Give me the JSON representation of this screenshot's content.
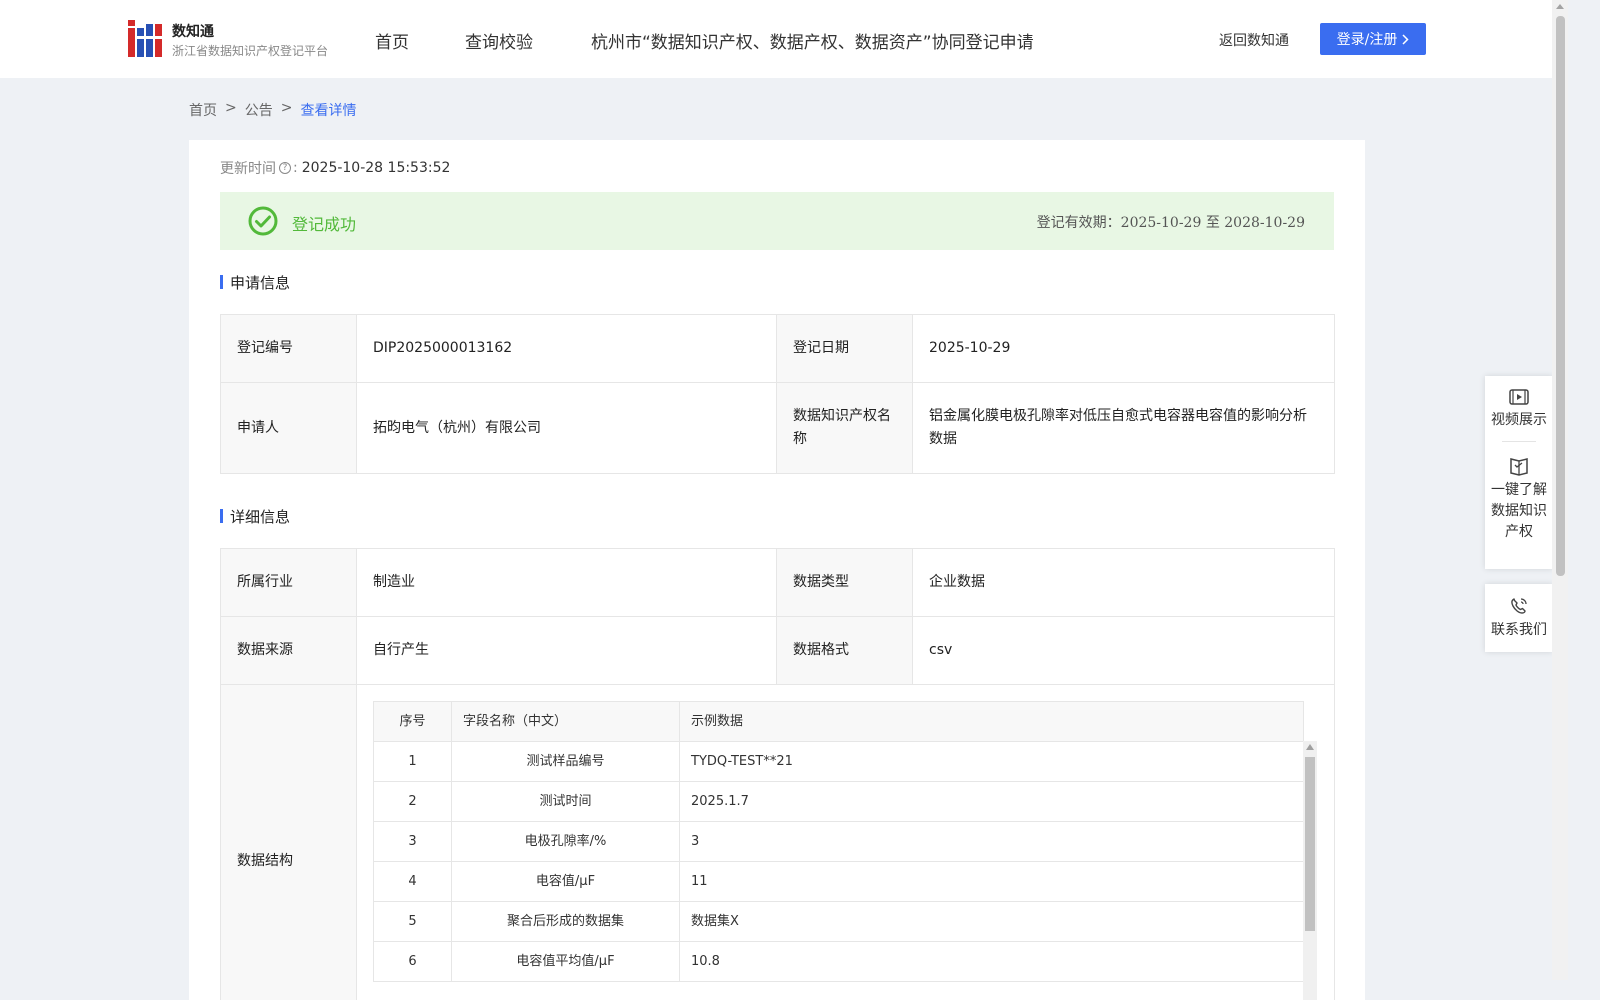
{
  "header": {
    "logo_title": "数知通",
    "logo_subtitle": "浙江省数据知识产权登记平台",
    "nav": [
      "首页",
      "查询校验",
      "杭州市“数据知识产权、数据产权、数据资产”协同登记申请"
    ],
    "back_link": "返回数知通",
    "login_label": "登录/注册"
  },
  "breadcrumb": [
    "首页",
    "公告",
    "查看详情"
  ],
  "update": {
    "label": "更新时间",
    "value": "2025-10-28 15:53:52"
  },
  "status": {
    "text": "登记成功",
    "validity_label": "登记有效期：",
    "validity_dates": "2025-10-29 至 2028-10-29",
    "color": "#52b93a"
  },
  "application_section": {
    "title": "申请信息",
    "rows": [
      [
        {
          "label": "登记编号",
          "value": "DIP2025000013162"
        },
        {
          "label": "登记日期",
          "value": "2025-10-29"
        }
      ],
      [
        {
          "label": "申请人",
          "value": "拓昀电气（杭州）有限公司"
        },
        {
          "label": "数据知识产权名称",
          "value": "铝金属化膜电极孔隙率对低压自愈式电容器电容值的影响分析数据"
        }
      ]
    ]
  },
  "detail_section": {
    "title": "详细信息",
    "rows": [
      [
        {
          "label": "所属行业",
          "value": "制造业"
        },
        {
          "label": "数据类型",
          "value": "企业数据"
        }
      ],
      [
        {
          "label": "数据来源",
          "value": "自行产生"
        },
        {
          "label": "数据格式",
          "value": "csv"
        }
      ]
    ],
    "structure_label": "数据结构",
    "structure_headers": [
      "序号",
      "字段名称（中文）",
      "示例数据"
    ],
    "structure_rows": [
      [
        "1",
        "测试样品编号",
        "TYDQ-TEST**21"
      ],
      [
        "2",
        "测试时间",
        "2025.1.7"
      ],
      [
        "3",
        "电极孔隙率/%",
        "3"
      ],
      [
        "4",
        "电容值/μF",
        "11"
      ],
      [
        "5",
        "聚合后形成的数据集",
        "数据集X"
      ],
      [
        "6",
        "电容值平均值/μF",
        "10.8"
      ]
    ]
  },
  "float_panel": {
    "video": "视频展示",
    "learn": "一键了解数据知识产权",
    "contact": "联系我们"
  },
  "colors": {
    "accent": "#3a6df0",
    "success": "#52b93a",
    "success_bg": "#e8f7e4",
    "page_bg": "#eef1f5"
  },
  "icons": [
    "logo-icon",
    "help-icon",
    "check-circle-icon",
    "video-icon",
    "book-icon",
    "phone-icon",
    "chevron-right-icon"
  ]
}
